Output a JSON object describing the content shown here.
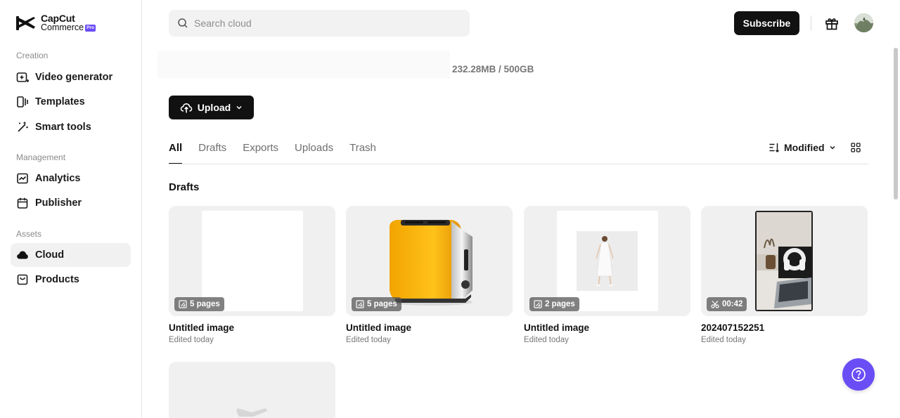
{
  "app": {
    "brand": "CapCut",
    "sub_brand": "Commerce",
    "badge": "Pro"
  },
  "sidebar": {
    "sections": [
      {
        "label": "Creation"
      },
      {
        "label": "Management"
      },
      {
        "label": "Assets"
      }
    ],
    "items": [
      {
        "label": "Video generator",
        "icon": "video-plus-icon"
      },
      {
        "label": "Templates",
        "icon": "templates-icon"
      },
      {
        "label": "Smart tools",
        "icon": "magic-wand-icon"
      },
      {
        "label": "Analytics",
        "icon": "analytics-icon"
      },
      {
        "label": "Publisher",
        "icon": "calendar-icon"
      },
      {
        "label": "Cloud",
        "icon": "cloud-icon",
        "active": true
      },
      {
        "label": "Products",
        "icon": "bag-icon"
      }
    ]
  },
  "header": {
    "search_placeholder": "Search cloud",
    "subscribe_label": "Subscribe"
  },
  "storage": {
    "text": "232.28MB / 500GB",
    "used_fraction": 0.00045
  },
  "toolbar": {
    "upload_label": "Upload"
  },
  "tabs": [
    {
      "label": "All",
      "active": true
    },
    {
      "label": "Drafts"
    },
    {
      "label": "Exports"
    },
    {
      "label": "Uploads"
    },
    {
      "label": "Trash"
    }
  ],
  "sort": {
    "label": "Modified"
  },
  "drafts": {
    "title": "Drafts",
    "cards": [
      {
        "name": "Untitled image",
        "sub": "Edited today",
        "badge": "5 pages",
        "badge_icon": "pages-icon"
      },
      {
        "name": "Untitled image",
        "sub": "Edited today",
        "badge": "5 pages",
        "badge_icon": "pages-icon"
      },
      {
        "name": "Untitled image",
        "sub": "Edited today",
        "badge": "2 pages",
        "badge_icon": "pages-icon"
      },
      {
        "name": "202407152251",
        "sub": "Edited today",
        "badge": "00:42",
        "badge_icon": "scissors-icon"
      }
    ]
  },
  "colors": {
    "accent": "#6b4df6",
    "primary_button": "#111111",
    "sidebar_active": "#f1f1f1"
  }
}
